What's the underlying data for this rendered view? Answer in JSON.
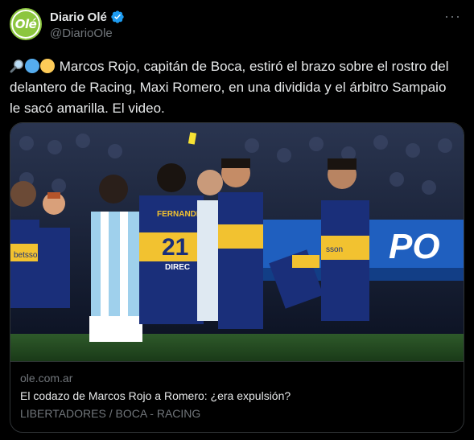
{
  "author": {
    "avatar_text": "Olé",
    "display_name": "Diario Olé",
    "handle": "@DiarioOle"
  },
  "icons": {
    "more": "more-options-icon",
    "verified": "verified-badge-icon"
  },
  "tweet": {
    "text": "Marcos Rojo, capitán de Boca, estiró el brazo sobre el rostro del delantero de Racing, Maxi Romero, en una dividida y el árbitro Sampaio le sacó amarilla. El video."
  },
  "card": {
    "image": {
      "jersey_number": "21",
      "jersey_name": "FERNANDEZ",
      "sponsor_left": "betsson",
      "sponsor_right": "sson",
      "banner_text": "PO",
      "sleeve_text": "DIREC"
    },
    "domain": "ole.com.ar",
    "title": "El codazo de Marcos Rojo a Romero: ¿era expulsión?",
    "description": "LIBERTADORES / BOCA - RACING"
  },
  "colors": {
    "boca_blue": "#1a2f7a",
    "boca_gold": "#f2c230",
    "racing_sky": "#9fd0ec",
    "verified_blue": "#1d9bf0"
  }
}
